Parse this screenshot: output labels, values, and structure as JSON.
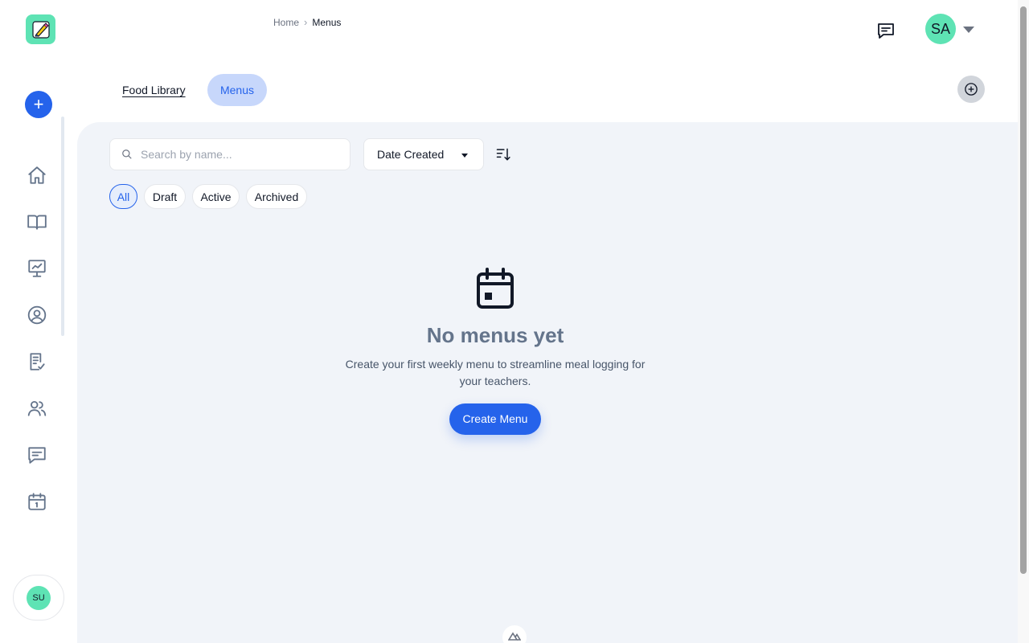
{
  "breadcrumb": {
    "home": "Home",
    "separator": "›",
    "current": "Menus"
  },
  "header": {
    "avatar_initials": "SA"
  },
  "sidebar": {
    "add_label": "+",
    "user_initials": "SU",
    "items": [
      {
        "name": "home",
        "icon": "home-icon"
      },
      {
        "name": "library",
        "icon": "book-open-icon"
      },
      {
        "name": "reports",
        "icon": "presentation-chart-icon"
      },
      {
        "name": "profile",
        "icon": "user-circle-icon"
      },
      {
        "name": "checklist",
        "icon": "clipboard-check-icon"
      },
      {
        "name": "people",
        "icon": "users-icon"
      },
      {
        "name": "messages",
        "icon": "message-icon"
      },
      {
        "name": "calendar",
        "icon": "calendar-icon"
      }
    ]
  },
  "tabs": [
    {
      "label": "Food Library",
      "active": false
    },
    {
      "label": "Menus",
      "active": true
    }
  ],
  "toolbar": {
    "search_placeholder": "Search by name...",
    "sort_value": "Date Created"
  },
  "filters": [
    {
      "label": "All",
      "active": true
    },
    {
      "label": "Draft",
      "active": false
    },
    {
      "label": "Active",
      "active": false
    },
    {
      "label": "Archived",
      "active": false
    }
  ],
  "empty_state": {
    "icon": "calendar-icon",
    "title": "No menus yet",
    "description": "Create your first weekly menu to streamline meal logging for your teachers.",
    "button_label": "Create Menu"
  },
  "colors": {
    "primary": "#2563eb",
    "accent_green": "#5ee3b4",
    "content_bg": "#f1f4f9",
    "active_tab_bg": "#c7d7fb"
  }
}
